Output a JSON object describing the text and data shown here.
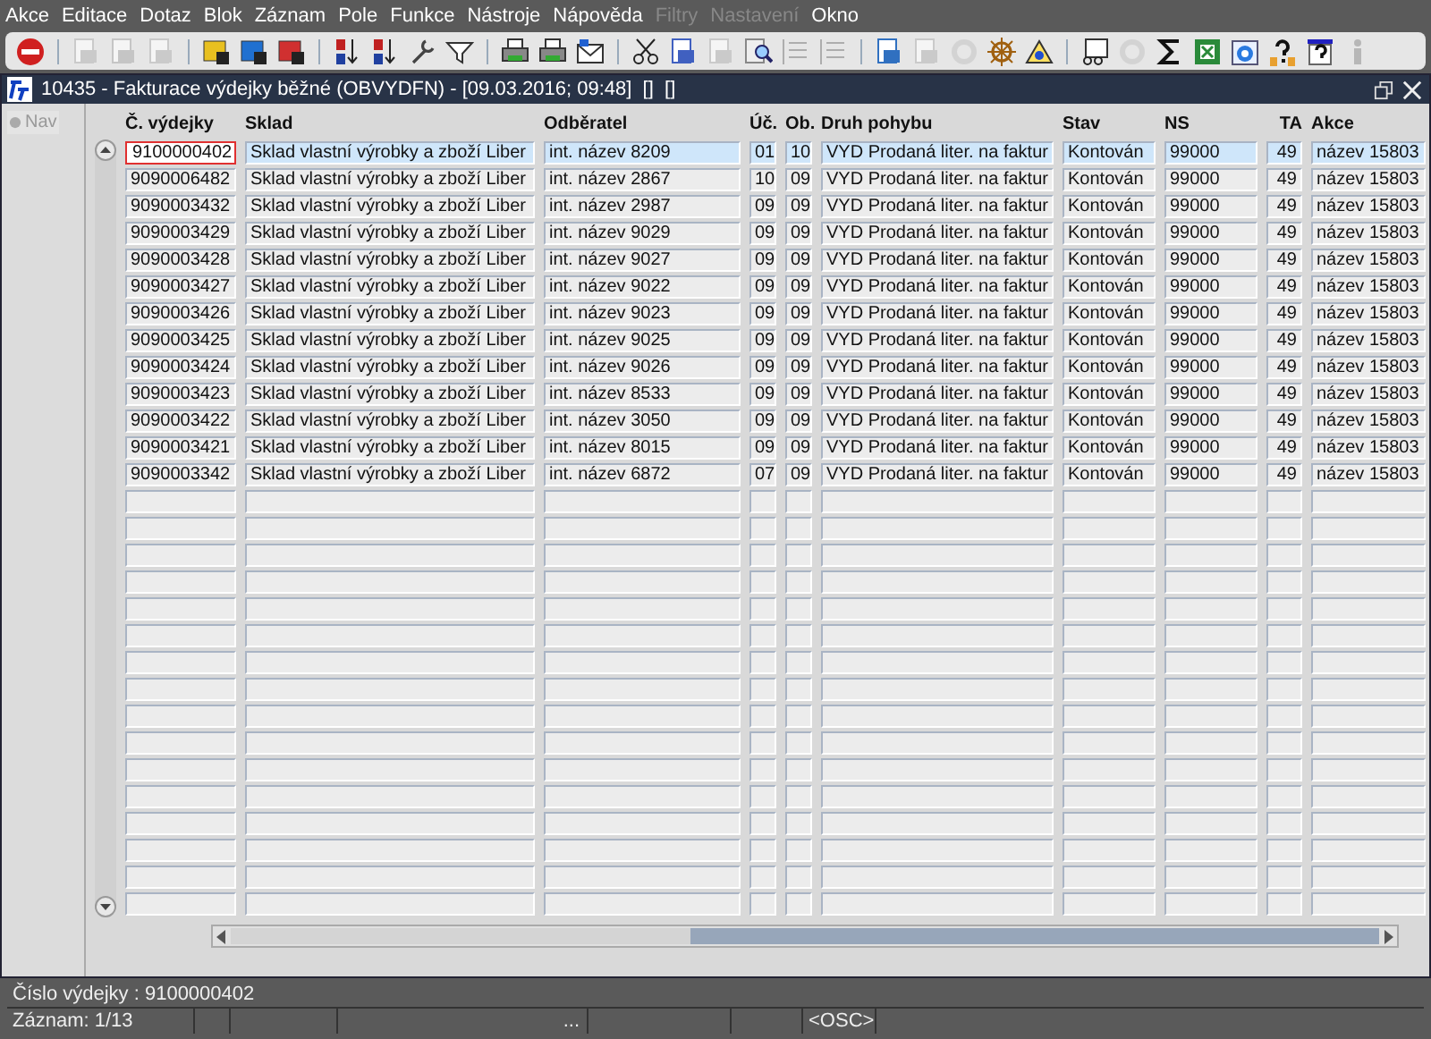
{
  "menu": [
    {
      "label": "Akce",
      "disabled": false
    },
    {
      "label": "Editace",
      "disabled": false
    },
    {
      "label": "Dotaz",
      "disabled": false
    },
    {
      "label": "Blok",
      "disabled": false
    },
    {
      "label": "Záznam",
      "disabled": false
    },
    {
      "label": "Pole",
      "disabled": false
    },
    {
      "label": "Funkce",
      "disabled": false
    },
    {
      "label": "Nástroje",
      "disabled": false
    },
    {
      "label": "Nápověda",
      "disabled": false
    },
    {
      "label": "Filtry",
      "disabled": true
    },
    {
      "label": "Nastavení",
      "disabled": true
    },
    {
      "label": "Okno",
      "disabled": false
    }
  ],
  "window": {
    "title": "10435 - Fakturace výdejky běžné (OBVYDFN) - [09.03.2016; 09:48]  []  []"
  },
  "nav": {
    "label": "Nav",
    "disabled": true
  },
  "table": {
    "columns": [
      "Č. výdejky",
      "Sklad",
      "Odběratel",
      "Úč.",
      "Ob.",
      "Druh pohybu",
      "Stav",
      "NS",
      "TA",
      "Akce"
    ],
    "rows": [
      {
        "selected": true,
        "cells": [
          "9100000402",
          "Sklad vlastní výrobky a zboží Liber",
          "int. název 8209",
          "01",
          "10",
          "VYD Prodaná liter. na faktur",
          "Kontován",
          "99000",
          "49",
          "název 15803"
        ]
      },
      {
        "selected": false,
        "cells": [
          "9090006482",
          "Sklad vlastní výrobky a zboží Liber",
          "int. název 2867",
          "10",
          "09",
          "VYD Prodaná liter. na faktur",
          "Kontován",
          "99000",
          "49",
          "název 15803"
        ]
      },
      {
        "selected": false,
        "cells": [
          "9090003432",
          "Sklad vlastní výrobky a zboží Liber",
          "int. název 2987",
          "09",
          "09",
          "VYD Prodaná liter. na faktur",
          "Kontován",
          "99000",
          "49",
          "název 15803"
        ]
      },
      {
        "selected": false,
        "cells": [
          "9090003429",
          "Sklad vlastní výrobky a zboží Liber",
          "int. název 9029",
          "09",
          "09",
          "VYD Prodaná liter. na faktur",
          "Kontován",
          "99000",
          "49",
          "název 15803"
        ]
      },
      {
        "selected": false,
        "cells": [
          "9090003428",
          "Sklad vlastní výrobky a zboží Liber",
          "int. název 9027",
          "09",
          "09",
          "VYD Prodaná liter. na faktur",
          "Kontován",
          "99000",
          "49",
          "název 15803"
        ]
      },
      {
        "selected": false,
        "cells": [
          "9090003427",
          "Sklad vlastní výrobky a zboží Liber",
          "int. název 9022",
          "09",
          "09",
          "VYD Prodaná liter. na faktur",
          "Kontován",
          "99000",
          "49",
          "název 15803"
        ]
      },
      {
        "selected": false,
        "cells": [
          "9090003426",
          "Sklad vlastní výrobky a zboží Liber",
          "int. název 9023",
          "09",
          "09",
          "VYD Prodaná liter. na faktur",
          "Kontován",
          "99000",
          "49",
          "název 15803"
        ]
      },
      {
        "selected": false,
        "cells": [
          "9090003425",
          "Sklad vlastní výrobky a zboží Liber",
          "int. název 9025",
          "09",
          "09",
          "VYD Prodaná liter. na faktur",
          "Kontován",
          "99000",
          "49",
          "název 15803"
        ]
      },
      {
        "selected": false,
        "cells": [
          "9090003424",
          "Sklad vlastní výrobky a zboží Liber",
          "int. název 9026",
          "09",
          "09",
          "VYD Prodaná liter. na faktur",
          "Kontován",
          "99000",
          "49",
          "název 15803"
        ]
      },
      {
        "selected": false,
        "cells": [
          "9090003423",
          "Sklad vlastní výrobky a zboží Liber",
          "int. název 8533",
          "09",
          "09",
          "VYD Prodaná liter. na faktur",
          "Kontován",
          "99000",
          "49",
          "název 15803"
        ]
      },
      {
        "selected": false,
        "cells": [
          "9090003422",
          "Sklad vlastní výrobky a zboží Liber",
          "int. název 3050",
          "09",
          "09",
          "VYD Prodaná liter. na faktur",
          "Kontován",
          "99000",
          "49",
          "název 15803"
        ]
      },
      {
        "selected": false,
        "cells": [
          "9090003421",
          "Sklad vlastní výrobky a zboží Liber",
          "int. název 8015",
          "09",
          "09",
          "VYD Prodaná liter. na faktur",
          "Kontován",
          "99000",
          "49",
          "název 15803"
        ]
      },
      {
        "selected": false,
        "cells": [
          "9090003342",
          "Sklad vlastní výrobky a zboží Liber",
          "int. název 6872",
          "07",
          "09",
          "VYD Prodaná liter. na faktur",
          "Kontován",
          "99000",
          "49",
          "název 15803"
        ]
      }
    ]
  },
  "status_bar": {
    "hint": "Číslo výdejky : 9100000402",
    "record": "Záznam: 1/13",
    "field_3": "...",
    "mode": "<OSC>"
  }
}
